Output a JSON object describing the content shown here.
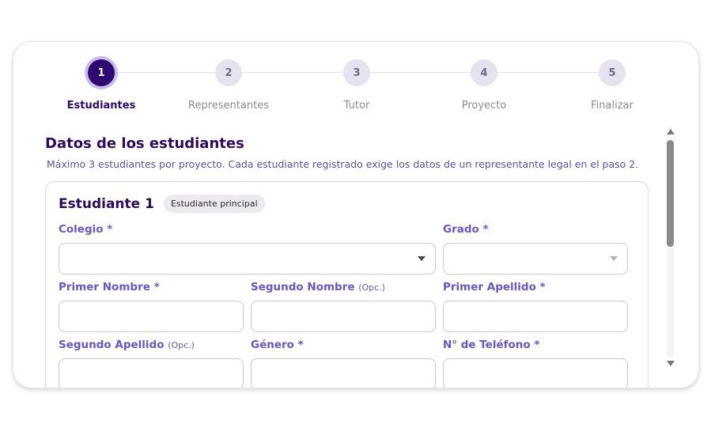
{
  "stepper": {
    "steps": [
      {
        "number": "1",
        "label": "Estudiantes",
        "active": true
      },
      {
        "number": "2",
        "label": "Representantes",
        "active": false
      },
      {
        "number": "3",
        "label": "Tutor",
        "active": false
      },
      {
        "number": "4",
        "label": "Proyecto",
        "active": false
      },
      {
        "number": "5",
        "label": "Finalizar",
        "active": false
      }
    ]
  },
  "section": {
    "title": "Datos de los estudiantes",
    "subtitle": "Máximo 3 estudiantes por proyecto. Cada estudiante registrado exige los datos de un representante legal en el paso 2."
  },
  "student": {
    "title": "Estudiante 1",
    "badge": "Estudiante principal",
    "fields": {
      "colegio": {
        "label": "Colegio *",
        "value": ""
      },
      "grado": {
        "label": "Grado *",
        "value": ""
      },
      "primer_nombre": {
        "label": "Primer Nombre *",
        "value": ""
      },
      "segundo_nombre": {
        "label": "Segundo Nombre",
        "opc": "(Opc.)",
        "value": ""
      },
      "primer_apellido": {
        "label": "Primer Apellido *",
        "value": ""
      },
      "segundo_apellido": {
        "label": "Segundo Apellido",
        "opc": "(Opc.)",
        "value": ""
      },
      "genero": {
        "label": "Género *",
        "value": ""
      },
      "telefono": {
        "label": "N° de Teléfono *",
        "value": ""
      }
    }
  },
  "colors": {
    "accent": "#2d0a72",
    "label": "#6a55c8",
    "subtitle": "#5b4fa8"
  }
}
